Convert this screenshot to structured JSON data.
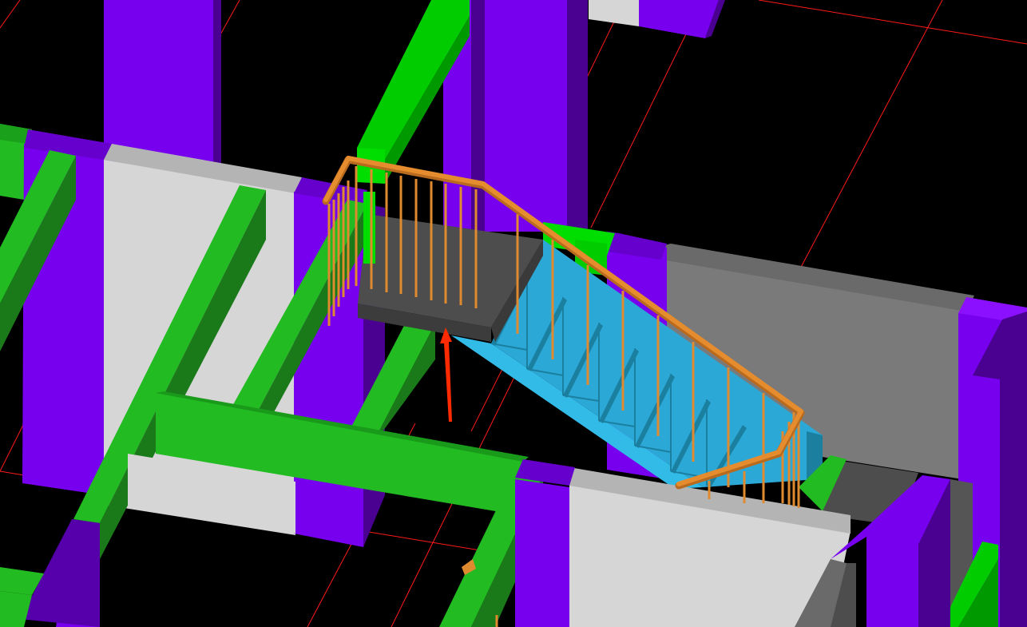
{
  "viewport": {
    "background": "#000000",
    "colors": {
      "grid": "#ff1a1a",
      "column_face": "#7700ee",
      "column_shade": "#4a0090",
      "beam_face": "#22bb22",
      "beam_side": "#1a7a1a",
      "beam_bright": "#00dd00",
      "wall_light": "#d6d6d6",
      "wall_top": "#b4b4b4",
      "wall_gray": "#7a7a7a",
      "landing": "#4d4d4d",
      "stair_tread": "#2ba8d6",
      "stair_riser": "#1b7fa0",
      "stair_soffit": "#33bbe8",
      "railing": "#e08a30",
      "arrow": "#ff2a00"
    }
  }
}
